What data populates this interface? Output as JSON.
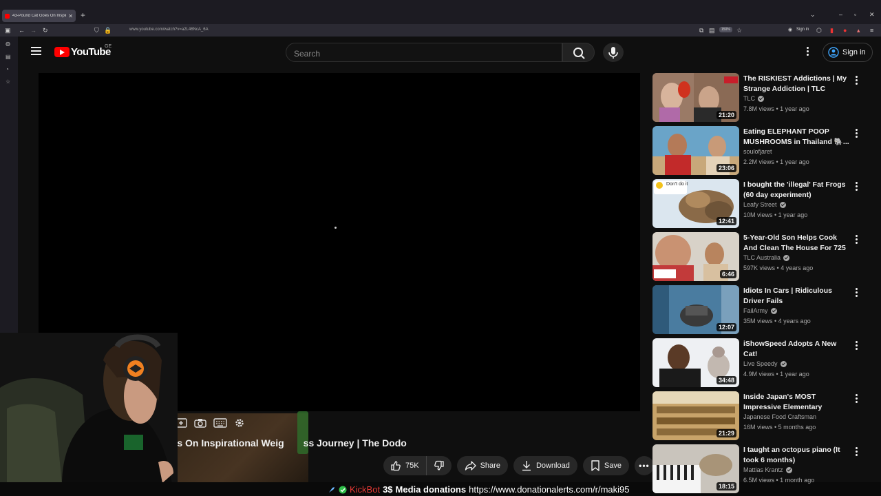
{
  "browser": {
    "tab_title": "43-Pound Cat Goes On Inspira",
    "url": "www.youtube.com/watch?v=a2L46NcA_6A",
    "zoom": "150%",
    "sign_in": "Sign in"
  },
  "header": {
    "logo_text": "YouTube",
    "country_code": "GE",
    "search_placeholder": "Search",
    "sign_in_label": "Sign in"
  },
  "video": {
    "title_visible": "oes On Inspirational Weig",
    "title_visible_end": "ss Journey | The Dodo",
    "likes": "75K",
    "share_label": "Share",
    "download_label": "Download",
    "save_label": "Save"
  },
  "donation_bar": {
    "bot_name": "KickBot",
    "amount": "3$",
    "label": "Media donations",
    "link": "https://www.donationalerts.com/r/maki95"
  },
  "related": [
    {
      "title": "The RISKIEST Addictions | My Strange Addiction | TLC",
      "channel": "TLC",
      "verified": true,
      "views": "7.8M views",
      "age": "1 year ago",
      "duration": "21:20"
    },
    {
      "title": "Eating ELEPHANT POOP MUSHROOMS in Thailand 🐘...",
      "channel": "soulofjaret",
      "verified": false,
      "views": "2.2M views",
      "age": "1 year ago",
      "duration": "23:06"
    },
    {
      "title": "I bought the 'illegal' Fat Frogs (60 day experiment)",
      "channel": "Leafy Street",
      "verified": true,
      "views": "10M views",
      "age": "1 year ago",
      "duration": "12:41",
      "thumb_caption": "Don't do it"
    },
    {
      "title": "5-Year-Old Son Helps Cook And Clean The House For 725 lb ...",
      "channel": "TLC Australia",
      "verified": true,
      "views": "597K views",
      "age": "4 years ago",
      "duration": "6:46"
    },
    {
      "title": "Idiots In Cars | Ridiculous Driver Fails",
      "channel": "FailArmy",
      "verified": true,
      "views": "35M views",
      "age": "4 years ago",
      "duration": "12:07"
    },
    {
      "title": "iShowSpeed Adopts A New Cat!",
      "channel": "Live Speedy",
      "verified": true,
      "views": "4.9M views",
      "age": "1 year ago",
      "duration": "34:48"
    },
    {
      "title": "Inside Japan's MOST Impressive Elementary School...",
      "channel": "Japanese Food Craftsman",
      "verified": false,
      "views": "16M views",
      "age": "5 months ago",
      "duration": "21:29"
    },
    {
      "title": "I taught an octopus piano (It took 6 months)",
      "channel": "Mattias Krantz",
      "verified": true,
      "views": "6.5M views",
      "age": "1 month ago",
      "duration": "18:15"
    }
  ],
  "colors": {
    "background": "#0f0f0f",
    "youtube_red": "#ff0000",
    "link_blue": "#3ea6ff"
  }
}
